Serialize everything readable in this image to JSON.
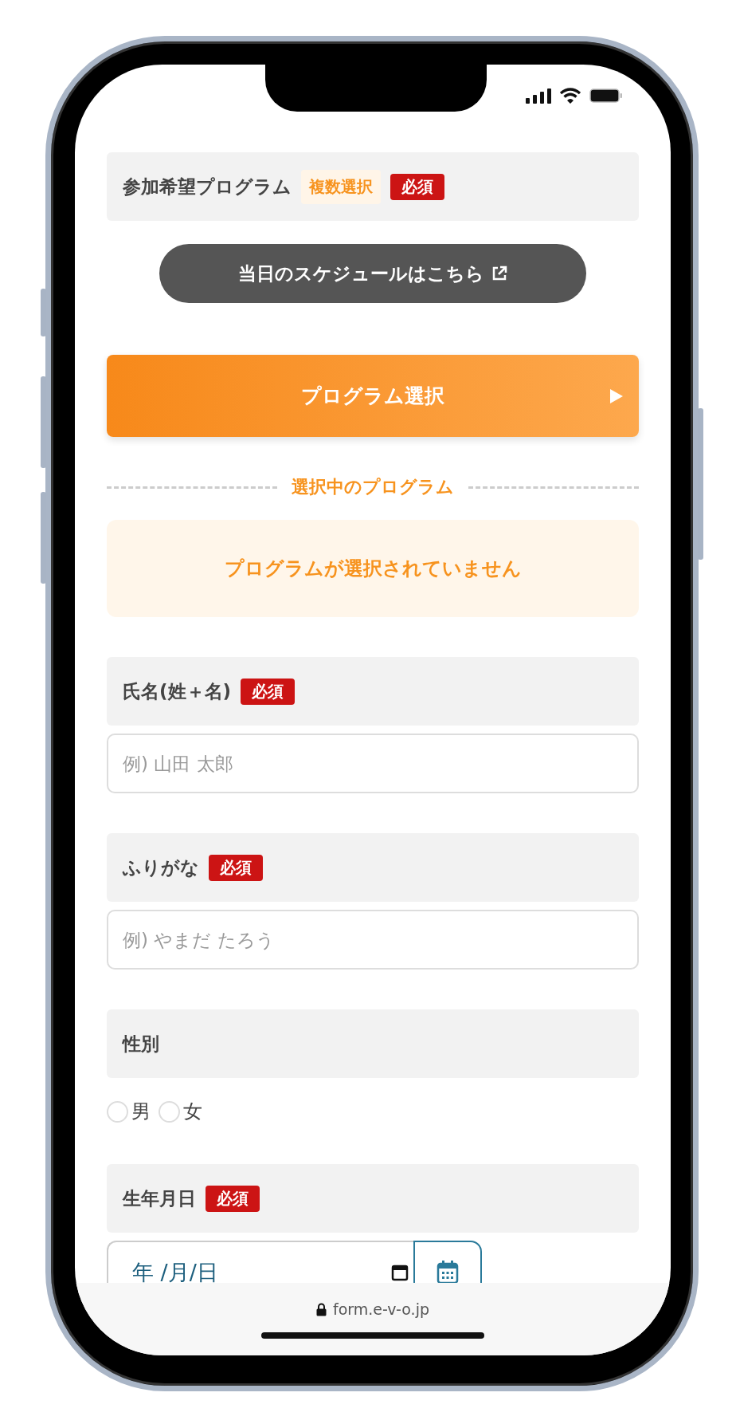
{
  "sections": [
    {
      "kind": "program",
      "label": "参加希望プログラム",
      "badges": [
        {
          "kind": "multi",
          "text": "複数選択"
        },
        {
          "kind": "required",
          "text": "必須"
        }
      ],
      "schedule_link": "当日のスケジュールはこちら",
      "select_button": "プログラム選択",
      "divider_label": "選択中のプログラム",
      "empty_message": "プログラムが選択されていません"
    },
    {
      "kind": "text",
      "label": "氏名(姓＋名)",
      "badges": [
        {
          "kind": "required",
          "text": "必須"
        }
      ],
      "placeholder": "例) 山田 太郎"
    },
    {
      "kind": "text",
      "label": "ふりがな",
      "badges": [
        {
          "kind": "required",
          "text": "必須"
        }
      ],
      "placeholder": "例) やまだ たろう"
    },
    {
      "kind": "radio",
      "label": "性別",
      "options": [
        {
          "label": "男",
          "selected": false
        },
        {
          "label": "女",
          "selected": false
        }
      ]
    },
    {
      "kind": "date",
      "label": "生年月日",
      "badges": [
        {
          "kind": "required",
          "text": "必須"
        }
      ],
      "value": "年 /月/日"
    }
  ],
  "browser_bar": {
    "url": "form.e-v-o.jp"
  }
}
